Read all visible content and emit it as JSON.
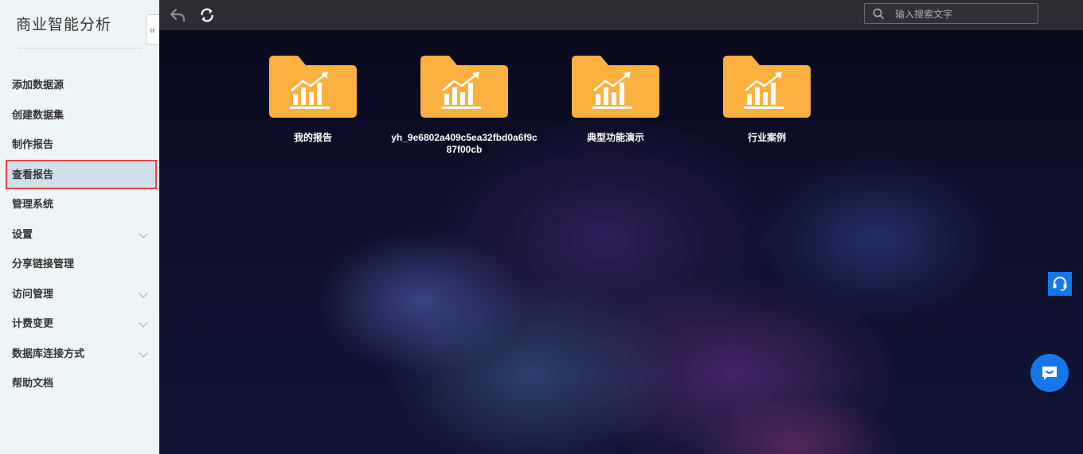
{
  "sidebar": {
    "app_title": "商业智能分析",
    "collapse_icon": "«",
    "items": [
      {
        "label": "添加数据源",
        "has_submenu": false
      },
      {
        "label": "创建数据集",
        "has_submenu": false
      },
      {
        "label": "制作报告",
        "has_submenu": false
      },
      {
        "label": "查看报告",
        "has_submenu": false,
        "active": true
      },
      {
        "label": "管理系统",
        "has_submenu": false
      },
      {
        "label": "设置",
        "has_submenu": true
      },
      {
        "label": "分享链接管理",
        "has_submenu": false
      },
      {
        "label": "访问管理",
        "has_submenu": true
      },
      {
        "label": "计费变更",
        "has_submenu": true
      },
      {
        "label": "数据库连接方式",
        "has_submenu": true
      },
      {
        "label": "帮助文档",
        "has_submenu": false
      }
    ]
  },
  "topbar": {
    "back_icon": "back-arrow-icon",
    "refresh_icon": "refresh-icon",
    "search": {
      "placeholder": "输入搜索文字",
      "value": "",
      "icon": "search-icon"
    }
  },
  "folders": [
    {
      "label": "我的报告"
    },
    {
      "label": "yh_9e6802a409c5ea32fbd0a6f9c87f00cb"
    },
    {
      "label": "典型功能演示"
    },
    {
      "label": "行业案例"
    }
  ],
  "floating": {
    "support_icon": "headset-icon",
    "chat_icon": "chat-bubble-icon"
  },
  "colors": {
    "accent": "#1677e8",
    "folder": "#fbb040",
    "active_outline": "#e84545",
    "topbar": "#2b2d33"
  }
}
